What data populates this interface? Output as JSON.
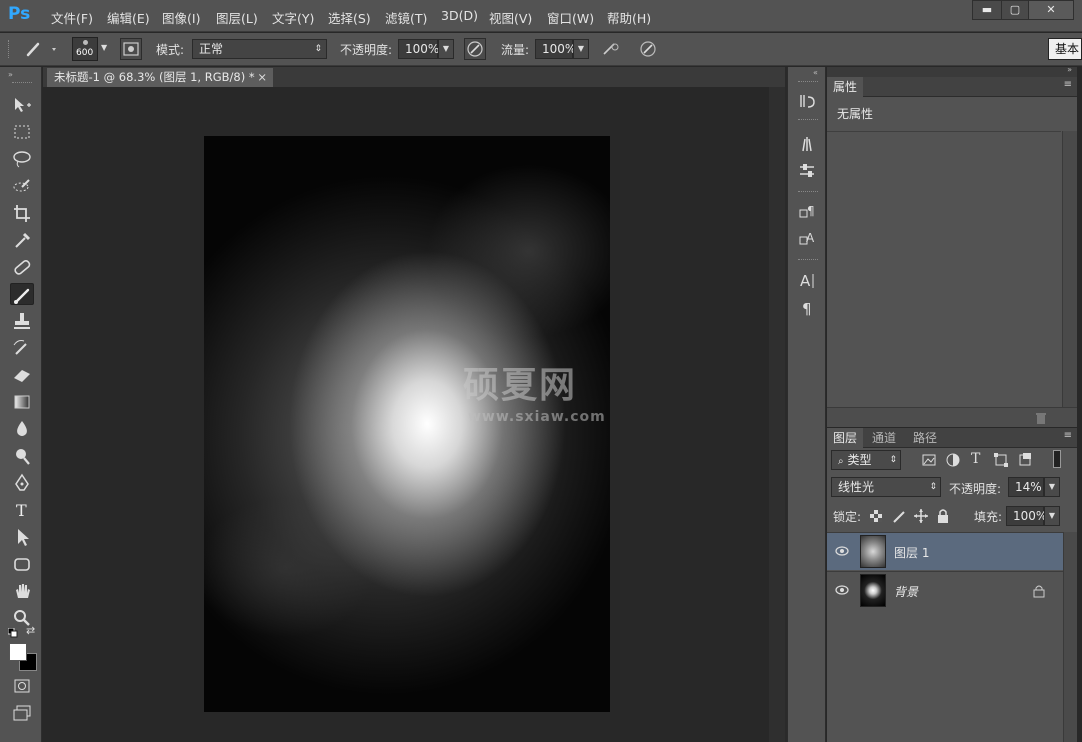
{
  "app": {
    "logo": "Ps"
  },
  "menu": [
    "文件(F)",
    "编辑(E)",
    "图像(I)",
    "图层(L)",
    "文字(Y)",
    "选择(S)",
    "滤镜(T)",
    "3D(D)",
    "视图(V)",
    "窗口(W)",
    "帮助(H)"
  ],
  "window_controls": {
    "minimize": "▬",
    "maximize": "▢",
    "close": "✕"
  },
  "options": {
    "brush_size": "600",
    "mode_label": "模式:",
    "mode_value": "正常",
    "opacity_label": "不透明度:",
    "opacity_value": "100%",
    "flow_label": "流量:",
    "flow_value": "100%",
    "workspace": "基本"
  },
  "document": {
    "tab_title": "未标题-1 @ 68.3% (图层 1, RGB/8) *",
    "tab_close": "×",
    "watermark_cn": "硕夏网",
    "watermark_url": "www.sxiaw.com"
  },
  "properties_panel": {
    "tab": "属性",
    "content": "无属性"
  },
  "layers_panel": {
    "tabs": [
      "图层",
      "通道",
      "路径"
    ],
    "filter_kind": "类型",
    "blend_mode": "线性光",
    "opacity_label": "不透明度:",
    "opacity_value": "14%",
    "lock_label": "锁定:",
    "fill_label": "填充:",
    "fill_value": "100%",
    "layers": [
      {
        "name": "图层 1",
        "selected": true
      },
      {
        "name": "背景",
        "locked": true
      }
    ]
  },
  "colors": {
    "panel_bg": "#535353",
    "workspace_bg": "#282828",
    "selected_layer": "#5b6a7e",
    "ps_blue": "#31a8ff"
  }
}
